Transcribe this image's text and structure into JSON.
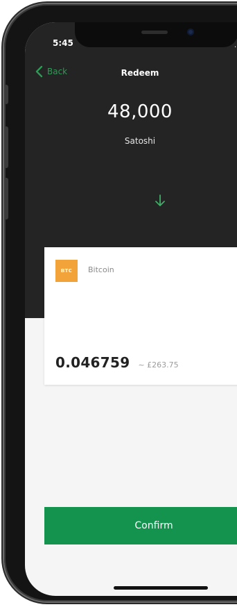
{
  "status_bar": {
    "time": "5:45",
    "signal_glyph": ".."
  },
  "nav": {
    "back_label": "Back",
    "title": "Redeem"
  },
  "redeem": {
    "amount": "48,000",
    "unit": "Satoshi"
  },
  "coin": {
    "badge": "BTC",
    "name": "Bitcoin",
    "value": "0.046759",
    "fiat_value": "~ £263.75"
  },
  "actions": {
    "confirm_label": "Confirm"
  },
  "colors": {
    "accent_green": "#14934e",
    "header_dark": "#242424",
    "btc_orange": "#f2a33a"
  }
}
